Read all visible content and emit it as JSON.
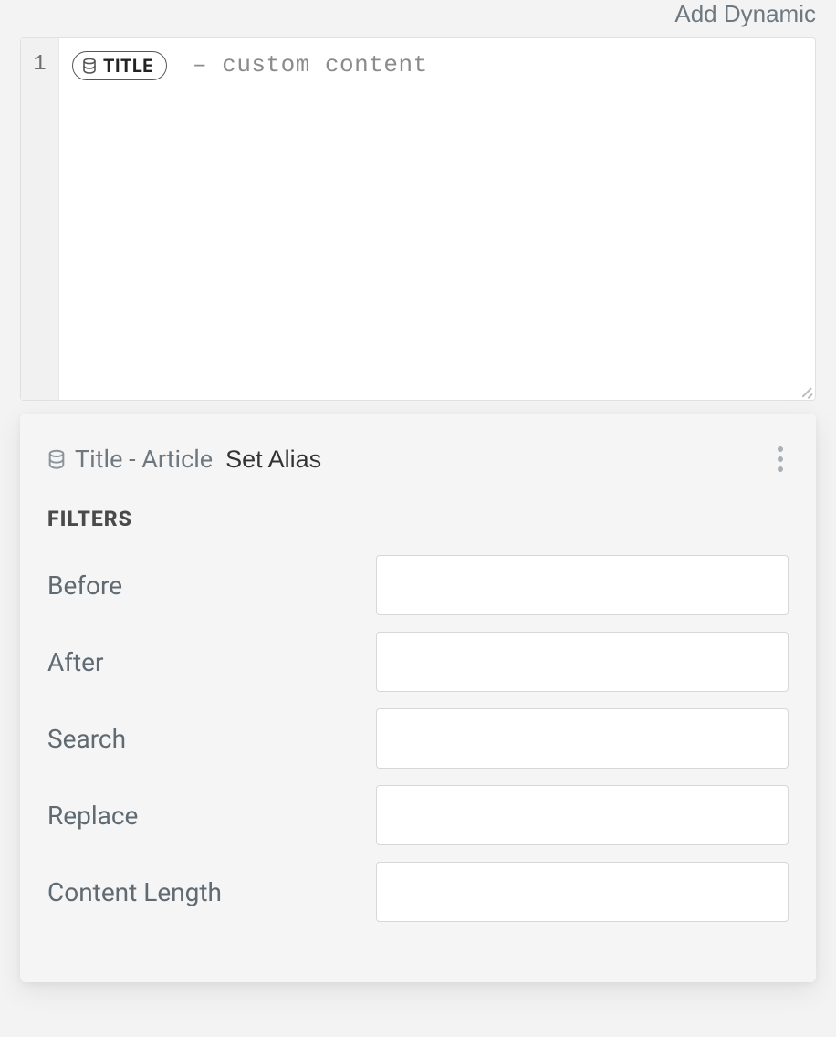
{
  "topbar": {
    "add_dynamic": "Add Dynamic"
  },
  "editor": {
    "line_number": "1",
    "pill_label": "TITLE",
    "suffix_text": " – custom content"
  },
  "panel": {
    "title": "Title - Article",
    "set_alias": "Set Alias",
    "filters_heading": "FILTERS",
    "filters": [
      {
        "label": "Before",
        "value": ""
      },
      {
        "label": "After",
        "value": ""
      },
      {
        "label": "Search",
        "value": ""
      },
      {
        "label": "Replace",
        "value": ""
      },
      {
        "label": "Content Length",
        "value": ""
      }
    ]
  }
}
